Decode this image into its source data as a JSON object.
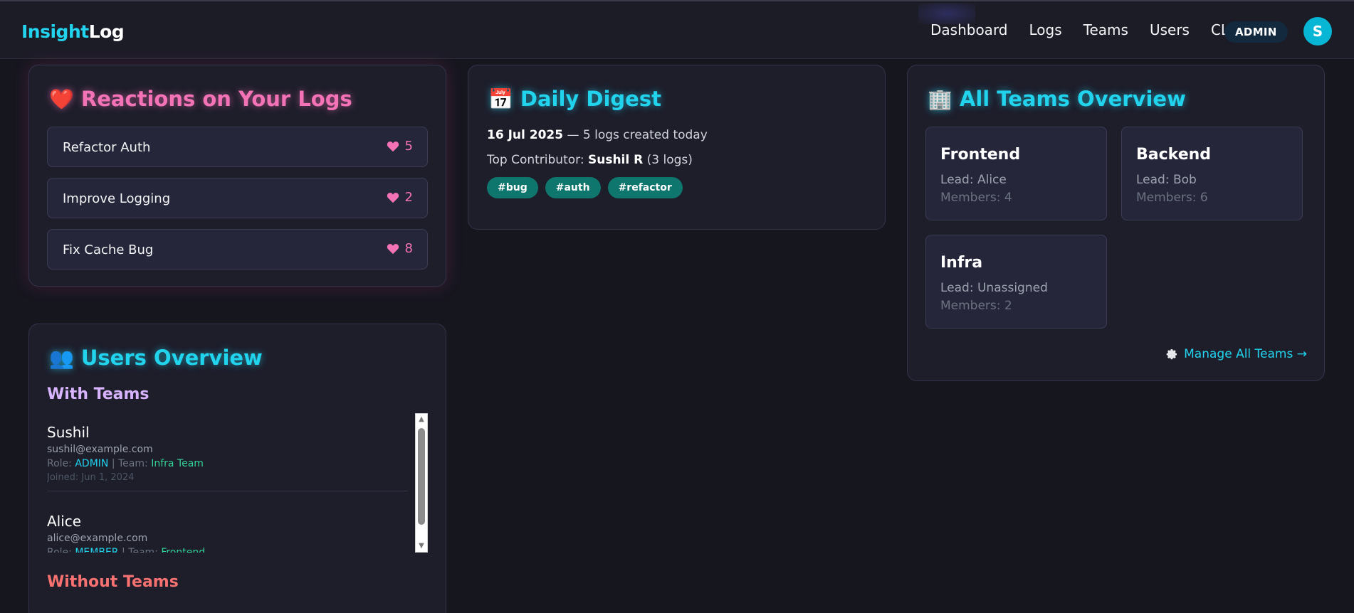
{
  "nav": {
    "brand_part1": "Insight",
    "brand_part2": "Log",
    "links": [
      "Dashboard",
      "Logs",
      "Teams",
      "Users",
      "CLI"
    ],
    "role_badge": "ADMIN",
    "avatar_initial": "S"
  },
  "reactions": {
    "emoji": "❤️",
    "title": "Reactions on Your Logs",
    "items": [
      {
        "title": "Refactor Auth",
        "count": "5"
      },
      {
        "title": "Improve Logging",
        "count": "2"
      },
      {
        "title": "Fix Cache Bug",
        "count": "8"
      }
    ]
  },
  "users": {
    "emoji": "👥",
    "title": "Users Overview",
    "with_teams_label": "With Teams",
    "without_teams_label": "Without Teams",
    "role_prefix": "Role:",
    "team_prefix": "| Team:",
    "joined_prefix": "Joined:",
    "list": [
      {
        "name": "Sushil",
        "email": "sushil@example.com",
        "role": "ADMIN",
        "team": "Infra Team",
        "joined": "Jun 1, 2024"
      },
      {
        "name": "Alice",
        "email": "alice@example.com",
        "role": "MEMBER",
        "team": "Frontend",
        "joined": ""
      }
    ]
  },
  "digest": {
    "emoji": "📅",
    "title": "Daily Digest",
    "date": "16 Jul 2025",
    "summary": "— 5 logs created today",
    "contributor_label": "Top Contributor:",
    "contributor_name": "Sushil R",
    "contributor_count": "(3 logs)",
    "tags": [
      "#bug",
      "#auth",
      "#refactor"
    ]
  },
  "teams": {
    "emoji": "🏢",
    "title": "All Teams Overview",
    "items": [
      {
        "name": "Frontend",
        "lead": "Lead: Alice",
        "members": "Members: 4"
      },
      {
        "name": "Backend",
        "lead": "Lead: Bob",
        "members": "Members: 6"
      },
      {
        "name": "Infra",
        "lead": "Lead: Unassigned",
        "members": "Members: 2"
      }
    ],
    "manage_link": "Manage All Teams →"
  },
  "colors": {
    "accent": "#22d3ee",
    "pink": "#f472b6",
    "tag": "#0f766e",
    "background": "#16161f",
    "card": "#1e1e2b"
  }
}
